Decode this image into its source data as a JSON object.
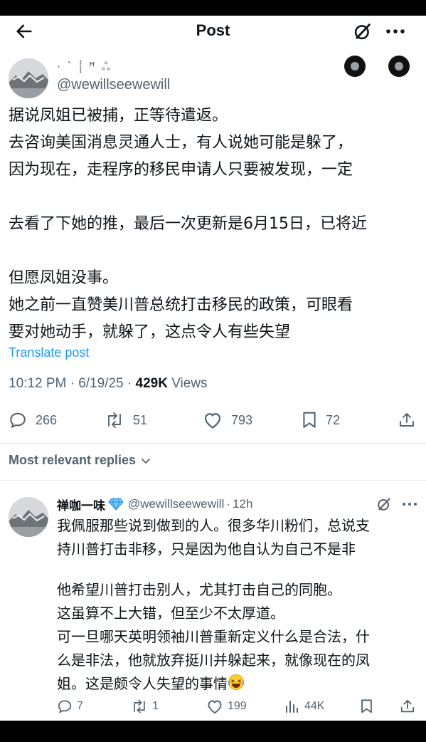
{
  "nav": {
    "title": "Post",
    "back_icon": "arrow-left-icon",
    "grok_icon": "grok-icon",
    "more_icon": "more-horizontal-icon"
  },
  "post": {
    "author_name": "· ` ⸽ ꟸ ஃ",
    "handle": "@wewillseewewill",
    "body": [
      "据说凤姐已被捕，正等待遣返。",
      "去咨询美国消息灵通人士，有人说她可能是躲了，",
      "因为现在，走程序的移民申请人只要被发现，一定",
      "",
      "去看了下她的推，最后一次更新是6月15日，已将近",
      "",
      "但愿凤姐没事。",
      "她之前一直赞美川普总统打击移民的政策，可眼看",
      "要对她动手，就躲了，这点令人有些失望"
    ],
    "translate_label": "Translate post",
    "timestamp": "10:12 PM · 6/19/25 · ",
    "views_count": "429K",
    "views_label": " Views",
    "stats": {
      "replies": "266",
      "reposts": "51",
      "likes": "793",
      "bookmarks": "72"
    }
  },
  "replies_sort": {
    "label": "Most relevant replies"
  },
  "reply": {
    "author_name": "禅咖一味",
    "handle": "@wewillseewewill",
    "separator": "·",
    "time": "12h",
    "body": [
      "我佩服那些说到做到的人。很多华川粉们，总说支",
      "持川普打击非移，只是因为他自认为自己不是非",
      "",
      "他希望川普打击别人，尤其打击自己的同胞。",
      "这虽算不上大错，但至少不太厚道。",
      "可一旦哪天英明领袖川普重新定义什么是合法，什",
      "么是非法，他就放弃挺川并躲起来，就像现在的凤",
      "姐。这是颇令人失望的事情"
    ],
    "stats": {
      "replies": "7",
      "reposts": "1",
      "likes": "199",
      "views": "44K"
    }
  },
  "colors": {
    "accent": "#1d9bf0",
    "text": "#0f1419",
    "secondary": "#536471",
    "divider": "#e6e9eb"
  }
}
